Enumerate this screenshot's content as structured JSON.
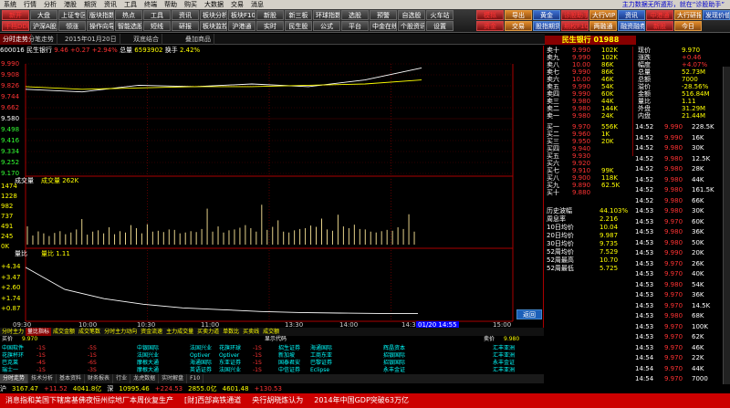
{
  "menu": {
    "items": [
      "系统",
      "行情",
      "分析",
      "港股",
      "期货",
      "资讯",
      "工具",
      "终端",
      "帮助",
      "购买",
      "大数据",
      "交易",
      "消息"
    ],
    "right_text": "主力数据无所遁形，就在“诊股助手”"
  },
  "toolbar": {
    "left_buttons": [
      "新开",
      "千档DDE2",
      "大盘",
      "沪深A股",
      "上证专区",
      "领涨",
      "版块指数",
      "操作向导",
      "热点",
      "智能选股",
      "工具",
      "短线",
      "资讯",
      "研报",
      "板块分析",
      "板块监控",
      "板块F10",
      "沪港通",
      "新股",
      "实时",
      "新三板",
      "民生股",
      "环球指数",
      "公式",
      "选股",
      "平台",
      "预警",
      "中金在线",
      "自选股",
      "个股资讯",
      "火车站",
      "设置"
    ],
    "right_buttons": [
      "模拟",
      "资金",
      "导出",
      "交易",
      "黄金",
      "股指期货",
      "诊股助手",
      "期权F10",
      "大行VIP",
      "两融通",
      "资讯",
      "融资融券",
      "中港通",
      "新股",
      "大行研报",
      "今日",
      "发现价值"
    ]
  },
  "tabs": [
    "分时走势",
    "分笔走势",
    "2015年01月20日",
    "双底结合",
    "叠加商品"
  ],
  "stock": {
    "code": "600016",
    "name": "民生银行",
    "price": "9.46",
    "change": "+0.27",
    "pct": "+2.94%",
    "vol_label": "总量",
    "volume": "6593902",
    "turnover_label": "换手",
    "turnover": "2.42%"
  },
  "price_axis": {
    "left": [
      "9.990",
      "9.908",
      "9.826",
      "9.744",
      "9.662",
      "9.580",
      "9.498",
      "9.416",
      "9.334",
      "9.252",
      "9.170"
    ],
    "right": [
      "4.28%",
      "3.42%",
      "2.57%",
      "1.71%",
      "0.86%",
      "0.00%",
      "0.86%",
      "1.71%",
      "2.57%",
      "3.42%",
      "4.28%"
    ]
  },
  "volume_axis": {
    "title": "成交量",
    "label": "成交量 262K",
    "left": [
      "1474",
      "1228",
      "982",
      "737",
      "491",
      "245",
      "0K"
    ]
  },
  "ratio_axis": {
    "title": "量比",
    "label": "量比 1.11",
    "left": [
      "+4.34",
      "+3.47",
      "+2.60",
      "+1.74",
      "+0.87"
    ]
  },
  "time_axis": [
    "09:30",
    "10:00",
    "10:30",
    "11:00",
    "13:30",
    "14:00",
    "14:30",
    "15:00"
  ],
  "time_box": "01/20 14:55",
  "return_label": "返回",
  "chart_data": {
    "type": "line",
    "title": "民生银行",
    "x": [
      "09:30",
      "10:00",
      "10:30",
      "11:00",
      "13:30",
      "14:00",
      "14:30",
      "15:00"
    ],
    "series": [
      {
        "name": "价格",
        "values": [
          9.8,
          9.78,
          9.83,
          9.82,
          9.84,
          9.82,
          9.87,
          9.96
        ]
      },
      {
        "name": "均价",
        "values": [
          9.82,
          9.8,
          9.81,
          9.82,
          9.82,
          9.83,
          9.84,
          9.87
        ]
      }
    ],
    "volume_bars": [
      420,
      210,
      305,
      260,
      198,
      270,
      310,
      240,
      280,
      350,
      590,
      230,
      300,
      330,
      260,
      400,
      240,
      310,
      280,
      450,
      380,
      260,
      470,
      300,
      320,
      290,
      350,
      340,
      260,
      280,
      310,
      290,
      360,
      830,
      300,
      420,
      280,
      330,
      350,
      390,
      450,
      380,
      300,
      920,
      340,
      410,
      560,
      300,
      280,
      330,
      360,
      380,
      440,
      410,
      600,
      350,
      320,
      690,
      420,
      380,
      460,
      360,
      350,
      300,
      280,
      310,
      340,
      320,
      400,
      360,
      700,
      300
    ],
    "ratio": [
      3.6,
      2.4,
      1.9,
      1.6,
      1.4,
      1.3,
      1.2,
      1.15,
      1.12,
      1.1,
      1.1
    ],
    "ylim": [
      9.17,
      9.99
    ],
    "xlabel": "",
    "ylabel": ""
  },
  "chart_tabs": [
    "分时主力",
    "量比指标",
    "成交金额",
    "成交笔数",
    "分时主力动向",
    "资金流速",
    "主力成交量",
    "买卖力道",
    "单数比",
    "买卖线",
    "成交额"
  ],
  "lists": {
    "header_left": "买价",
    "header_left_val": "9.970",
    "header_mid": "显示代码",
    "header_right": "卖价",
    "header_right_val": "9.980",
    "col1": [
      "中国软件",
      "花旗杯环",
      "巴克莱",
      "瑞士一"
    ],
    "col2": [
      "-1S",
      "-1S",
      "-4S",
      "-1S"
    ],
    "col3": [
      "-5S",
      "-1S",
      "-6S",
      "-3S"
    ],
    "col4": [
      "中银国际",
      "法国兴业",
      "摩根大通",
      "摩根大通"
    ],
    "col5": [
      "法国兴业",
      "Optiver",
      "海通国际",
      "英语证券"
    ],
    "col6": [
      "花旗环球",
      "Optiver",
      "东亚证券",
      "法国兴业"
    ],
    "col7": [
      "-1S",
      "-1S",
      "-1S",
      "-1S"
    ],
    "col8": [
      "招生证券",
      "新加坡",
      "国泰君安",
      "中信证券"
    ],
    "col9": [
      "海通国际",
      "工商东亚",
      "巴黎证券",
      "Eclipse"
    ],
    "col10": [
      "辉晶资本",
      "招银国际",
      "招银国际",
      "永丰金证"
    ],
    "col11": [
      "汇丰亚洲",
      "汇丰亚洲",
      "永丰金证",
      "汇丰亚洲"
    ]
  },
  "bottom_tabs": [
    "分时走势",
    "技术分析",
    "基本资料",
    "财务报表",
    "行业",
    "龙虎数据",
    "实时解盘",
    "F10"
  ],
  "right_panel": {
    "title": "民生银行 01988",
    "sell_levels": [
      {
        "label": "卖十",
        "price": "9.990",
        "vol": "102K"
      },
      {
        "label": "卖九",
        "price": "9.990",
        "vol": "102K"
      },
      {
        "label": "卖八",
        "price": "10.00",
        "vol": "86K"
      },
      {
        "label": "卖七",
        "price": "9.990",
        "vol": "86K"
      },
      {
        "label": "卖六",
        "price": "10.00",
        "vol": "46K"
      },
      {
        "label": "卖五",
        "price": "9.990",
        "vol": "54K"
      },
      {
        "label": "卖四",
        "price": "9.990",
        "vol": "60K"
      },
      {
        "label": "卖三",
        "price": "9.980",
        "vol": "44K"
      },
      {
        "label": "卖二",
        "price": "9.980",
        "vol": "144K"
      },
      {
        "label": "卖一",
        "price": "9.980",
        "vol": "24K"
      }
    ],
    "buy_levels": [
      {
        "label": "买一",
        "price": "9.970",
        "vol": "556K"
      },
      {
        "label": "买二",
        "price": "9.960",
        "vol": "1K"
      },
      {
        "label": "买三",
        "price": "9.950",
        "vol": "20K"
      },
      {
        "label": "买四",
        "price": "9.940",
        "vol": ""
      },
      {
        "label": "买五",
        "price": "9.930",
        "vol": ""
      },
      {
        "label": "买六",
        "price": "9.920",
        "vol": ""
      },
      {
        "label": "买七",
        "price": "9.910",
        "vol": "99K"
      },
      {
        "label": "买八",
        "price": "9.900",
        "vol": "118K"
      },
      {
        "label": "买九",
        "price": "9.890",
        "vol": "62.5K"
      },
      {
        "label": "买十",
        "price": "9.880",
        "vol": ""
      }
    ],
    "info": [
      {
        "label": "现价",
        "value": "9.970"
      },
      {
        "label": "涨跌",
        "value": "+0.46"
      },
      {
        "label": "幅度",
        "value": "+4.07%"
      },
      {
        "label": "总量",
        "value": "52.73M"
      },
      {
        "label": "总额",
        "value": "7000"
      },
      {
        "label": "溢价",
        "value": "-28.56%"
      },
      {
        "label": "金额",
        "value": "516.84M"
      },
      {
        "label": "量比",
        "value": "1.11"
      },
      {
        "label": "外盘",
        "value": "31.29M"
      },
      {
        "label": "内盘",
        "value": "21.44M"
      }
    ],
    "stats": [
      {
        "label": "历史波幅",
        "value": "44.103%"
      },
      {
        "label": "周息率",
        "value": "2.216"
      },
      {
        "label": "10日均价",
        "value": "10.04"
      },
      {
        "label": "20日均价",
        "value": "9.987"
      },
      {
        "label": "30日均价",
        "value": "9.735"
      },
      {
        "label": "52周均价",
        "value": "7.529"
      },
      {
        "label": "52周最高",
        "value": "10.70"
      },
      {
        "label": "52周最低",
        "value": "5.725"
      }
    ],
    "trades": [
      {
        "time": "14:52",
        "price": "9.990",
        "vol": "228.5K"
      },
      {
        "time": "14:52",
        "price": "9.990",
        "vol": "16K"
      },
      {
        "time": "14:52",
        "price": "9.980",
        "vol": "30K"
      },
      {
        "time": "14:52",
        "price": "9.980",
        "vol": "12.5K"
      },
      {
        "time": "14:52",
        "price": "9.980",
        "vol": "28K"
      },
      {
        "time": "14:52",
        "price": "9.980",
        "vol": "44K"
      },
      {
        "time": "14:52",
        "price": "9.980",
        "vol": "161.5K"
      },
      {
        "time": "14:52",
        "price": "9.980",
        "vol": "66K"
      },
      {
        "time": "14:53",
        "price": "9.980",
        "vol": "30K"
      },
      {
        "time": "14:53",
        "price": "9.970",
        "vol": "60K"
      },
      {
        "time": "14:53",
        "price": "9.980",
        "vol": "36K"
      },
      {
        "time": "14:53",
        "price": "9.980",
        "vol": "50K"
      },
      {
        "time": "14:53",
        "price": "9.990",
        "vol": "20K"
      },
      {
        "time": "14:53",
        "price": "9.970",
        "vol": "26K"
      },
      {
        "time": "14:53",
        "price": "9.970",
        "vol": "40K"
      },
      {
        "time": "14:53",
        "price": "9.980",
        "vol": "54K"
      },
      {
        "time": "14:53",
        "price": "9.970",
        "vol": "36K"
      },
      {
        "time": "14:53",
        "price": "9.970",
        "vol": "14.5K"
      },
      {
        "time": "14:53",
        "price": "9.980",
        "vol": "68K"
      },
      {
        "time": "14:53",
        "price": "9.970",
        "vol": "100K"
      },
      {
        "time": "14:53",
        "price": "9.970",
        "vol": "62K"
      },
      {
        "time": "14:53",
        "price": "9.970",
        "vol": "46K"
      },
      {
        "time": "14:54",
        "price": "9.970",
        "vol": "22K"
      },
      {
        "time": "14:54",
        "price": "9.970",
        "vol": "44K"
      },
      {
        "time": "14:54",
        "price": "9.970",
        "vol": "7000"
      }
    ]
  },
  "indexbar": [
    {
      "name": "沪",
      "value": "3167.47",
      "chg": "+11.52"
    },
    {
      "name": "",
      "value": "4041.8亿"
    },
    {
      "name": "深",
      "value": "10995.46",
      "chg": "+224.53"
    },
    {
      "name": "",
      "value": "2855.0亿"
    },
    {
      "name": "",
      "value": "4601.48",
      "chg": "+130.53"
    }
  ],
  "news": [
    "消息指和美国下辖席基佛夜恒州综地厂本周伙复生产",
    "[财]西部高铁通道",
    "央行胡晓炼认为",
    "2014年中国GDP突破63万亿"
  ]
}
